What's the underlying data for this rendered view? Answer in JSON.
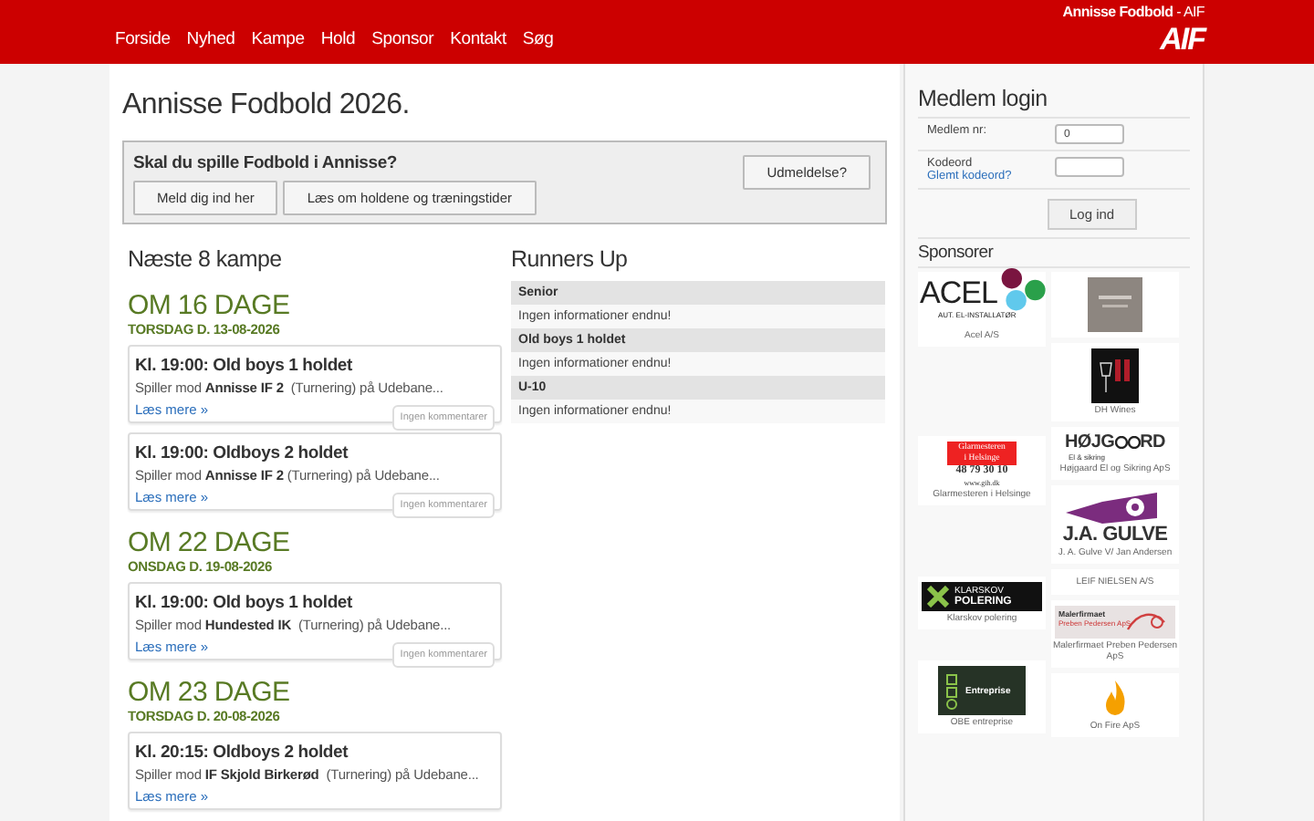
{
  "header": {
    "site_title": "Annisse Fodbold",
    "site_suffix": "- AIF",
    "logo_text": "AIF",
    "nav": [
      "Forside",
      "Nyhed",
      "Kampe",
      "Hold",
      "Sponsor",
      "Kontakt",
      "Søg"
    ]
  },
  "main": {
    "title": "Annisse Fodbold 2026.",
    "signup": {
      "question": "Skal du spille Fodbold i Annisse?",
      "buttons": [
        "Meld dig ind her",
        "Læs om holdene og træningstider"
      ],
      "resign_button": "Udmeldelse?"
    },
    "matches": {
      "heading": "Næste 8 kampe",
      "groups": [
        {
          "countdown": "OM 16 DAGE",
          "date": "TORSDAG D. 13-08-2026",
          "matches": [
            {
              "title": "Kl. 19:00: Old boys 1 holdet",
              "text": "Spiller mod **Annisse IF 2**  (Turnering) på Udebane...",
              "link": "Læs mere »",
              "comments": "Ingen kommentarer"
            },
            {
              "title": "Kl. 19:00: Oldboys 2 holdet",
              "text": "Spiller mod **Annisse IF 2** (Turnering) på Udebane...",
              "link": "Læs mere »",
              "comments": "Ingen kommentarer"
            }
          ]
        },
        {
          "countdown": "OM 22 DAGE",
          "date": "ONSDAG D. 19-08-2026",
          "matches": [
            {
              "title": "Kl. 19:00: Old boys 1 holdet",
              "text": "Spiller mod **Hundested IK**  (Turnering) på Udebane...",
              "link": "Læs mere »",
              "comments": "Ingen kommentarer"
            }
          ]
        },
        {
          "countdown": "OM 23 DAGE",
          "date": "TORSDAG D. 20-08-2026",
          "matches": [
            {
              "title": "Kl. 20:15: Oldboys 2 holdet",
              "text": "Spiller mod **IF Skjold Birkerød**  (Turnering) på Udebane...",
              "link": "Læs mere »"
            }
          ]
        }
      ]
    },
    "runners_up": {
      "heading": "Runners Up",
      "rows": [
        {
          "team": "Senior",
          "info": "Ingen informationer endnu!"
        },
        {
          "team": "Old boys 1 holdet",
          "info": "Ingen informationer endnu!"
        },
        {
          "team": "U-10",
          "info": "Ingen informationer endnu!"
        }
      ]
    }
  },
  "login": {
    "title": "Medlem login",
    "member_label": "Medlem nr:",
    "member_value": "0",
    "password_label": "Kodeord",
    "forgot_link": "Glemt kodeord?",
    "button": "Log ind"
  },
  "sponsors": {
    "heading": "Sponsorer",
    "items": [
      {
        "kind": "acel",
        "logo_lines": [
          "ACEL",
          "AUT. EL-INSTALLATØR"
        ],
        "caption": "Acel A/S"
      },
      {
        "kind": "plain"
      },
      {
        "kind": "wine",
        "caption": "DH Wines"
      },
      {
        "kind": "glass",
        "logo_lines": [
          "Glarmesteren",
          "i Helsinge",
          "48 79 30 10",
          "www.gih.dk"
        ],
        "caption": "Glarmesteren i Helsinge"
      },
      {
        "kind": "hojgaard",
        "logo_lines": [
          "HØJG",
          "RD",
          "El & sikring"
        ],
        "caption": "Højgaard El og Sikring ApS"
      },
      {
        "kind": "gulve",
        "logo_lines": [
          "J.A. GULVE"
        ],
        "caption": "J. A. Gulve V/ Jan Andersen"
      },
      {
        "kind": "klarskov",
        "logo_lines": [
          "KLARSKOV",
          "POLERING"
        ],
        "caption": "Klarskov polering"
      },
      {
        "kind": "none",
        "caption": "LEIF NIELSEN A/S"
      },
      {
        "kind": "painter",
        "logo_lines": [
          "Malerfirmaet",
          "Preben Pedersen ApS"
        ],
        "caption": "Malerfirmaet Preben Pedersen ApS"
      },
      {
        "kind": "obe",
        "logo_lines": [
          "Entreprise"
        ],
        "caption": "OBE entreprise"
      },
      {
        "kind": "fire",
        "caption": "On Fire ApS"
      }
    ]
  }
}
